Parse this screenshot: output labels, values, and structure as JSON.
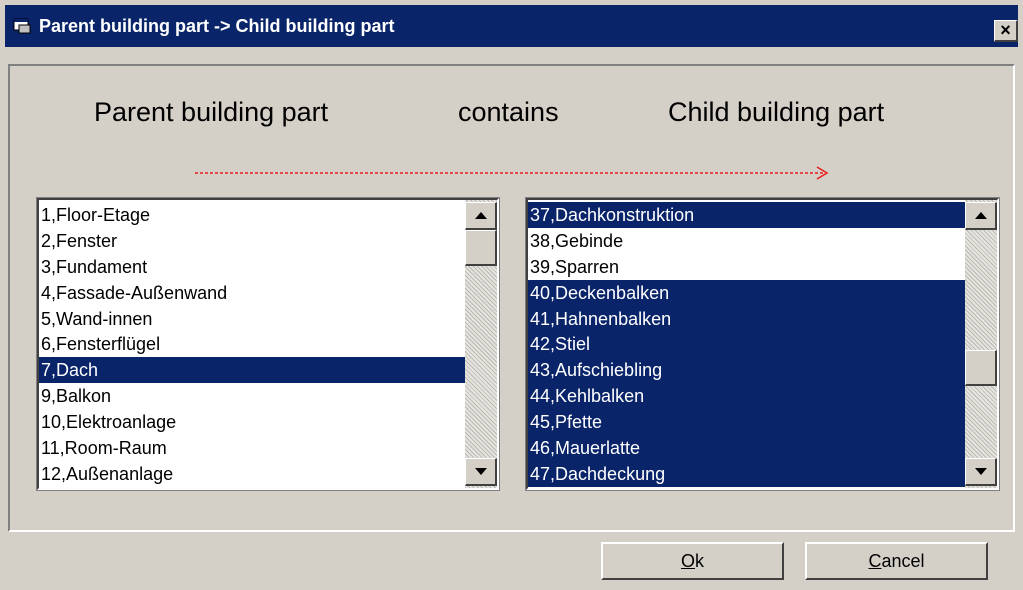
{
  "window": {
    "title": "Parent building part -> Child building part",
    "close_glyph": "×"
  },
  "header": {
    "parent_label": "Parent building part",
    "contains_label": "contains",
    "child_label": "Child building part",
    "arrow_color": "#e81c1c"
  },
  "parent_list": {
    "items": [
      {
        "label": "1,Floor-Etage",
        "selected": false
      },
      {
        "label": "2,Fenster",
        "selected": false
      },
      {
        "label": "3,Fundament",
        "selected": false
      },
      {
        "label": "4,Fassade-Außenwand",
        "selected": false
      },
      {
        "label": "5,Wand-innen",
        "selected": false
      },
      {
        "label": "6,Fensterflügel",
        "selected": false
      },
      {
        "label": "7,Dach",
        "selected": true
      },
      {
        "label": "9,Balkon",
        "selected": false
      },
      {
        "label": "10,Elektroanlage",
        "selected": false
      },
      {
        "label": "11,Room-Raum",
        "selected": false
      },
      {
        "label": "12,Außenanlage",
        "selected": false
      }
    ]
  },
  "child_list": {
    "items": [
      {
        "label": "37,Dachkonstruktion",
        "selected": true
      },
      {
        "label": "38,Gebinde",
        "selected": false
      },
      {
        "label": "39,Sparren",
        "selected": false
      },
      {
        "label": "40,Deckenbalken",
        "selected": true
      },
      {
        "label": "41,Hahnenbalken",
        "selected": true
      },
      {
        "label": "42,Stiel",
        "selected": true
      },
      {
        "label": "43,Aufschiebling",
        "selected": true
      },
      {
        "label": "44,Kehlbalken",
        "selected": true
      },
      {
        "label": "45,Pfette",
        "selected": true
      },
      {
        "label": "46,Mauerlatte",
        "selected": true
      },
      {
        "label": "47,Dachdeckung",
        "selected": true
      }
    ]
  },
  "buttons": {
    "ok_mnemonic": "O",
    "ok_rest": "k",
    "cancel_mnemonic": "C",
    "cancel_rest": "ancel"
  },
  "colors": {
    "selection": "#0a246a",
    "dialog": "#d4d0c8"
  }
}
